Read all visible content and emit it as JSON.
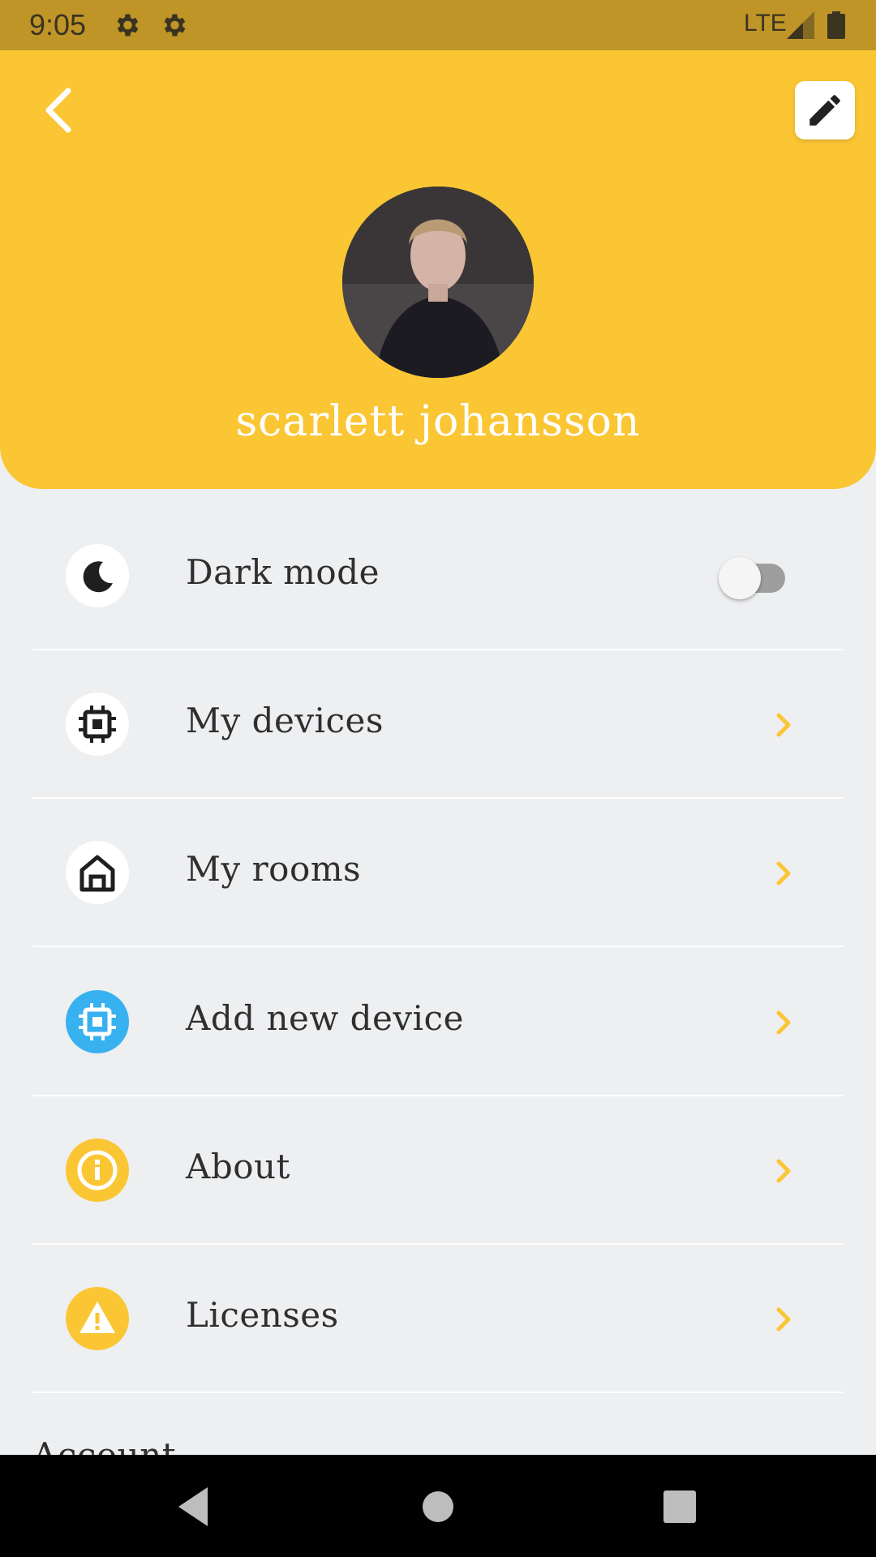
{
  "status_bar": {
    "time": "9:05",
    "network": "LTE",
    "icons": [
      "gear-icon",
      "gear-icon",
      "signal-icon",
      "battery-icon"
    ]
  },
  "header": {
    "back_icon": "chevron-left-icon",
    "edit_icon": "pencil-icon",
    "profile_name": "scarlett johansson"
  },
  "menu": {
    "items": [
      {
        "label": "Dark mode",
        "icon": "moon-icon",
        "control": "toggle",
        "enabled": false
      },
      {
        "label": "My devices",
        "icon": "chip-icon",
        "control": "chevron"
      },
      {
        "label": "My rooms",
        "icon": "home-icon",
        "control": "chevron"
      },
      {
        "label": "Add new device",
        "icon": "chip-icon",
        "control": "chevron"
      },
      {
        "label": "About",
        "icon": "info-icon",
        "control": "chevron"
      },
      {
        "label": "Licenses",
        "icon": "warning-icon",
        "control": "chevron"
      }
    ],
    "section_label": "Account"
  },
  "colors": {
    "status_bar": "#BF9528",
    "header": "#FBC634",
    "accent": "#FBC634",
    "blue_icon": "#38B1F0",
    "background": "#EEEFF1",
    "toggle_track": "#9E9E9E"
  },
  "nav_bar": {
    "icons": [
      "back-triangle-icon",
      "home-circle-icon",
      "recents-square-icon"
    ]
  }
}
